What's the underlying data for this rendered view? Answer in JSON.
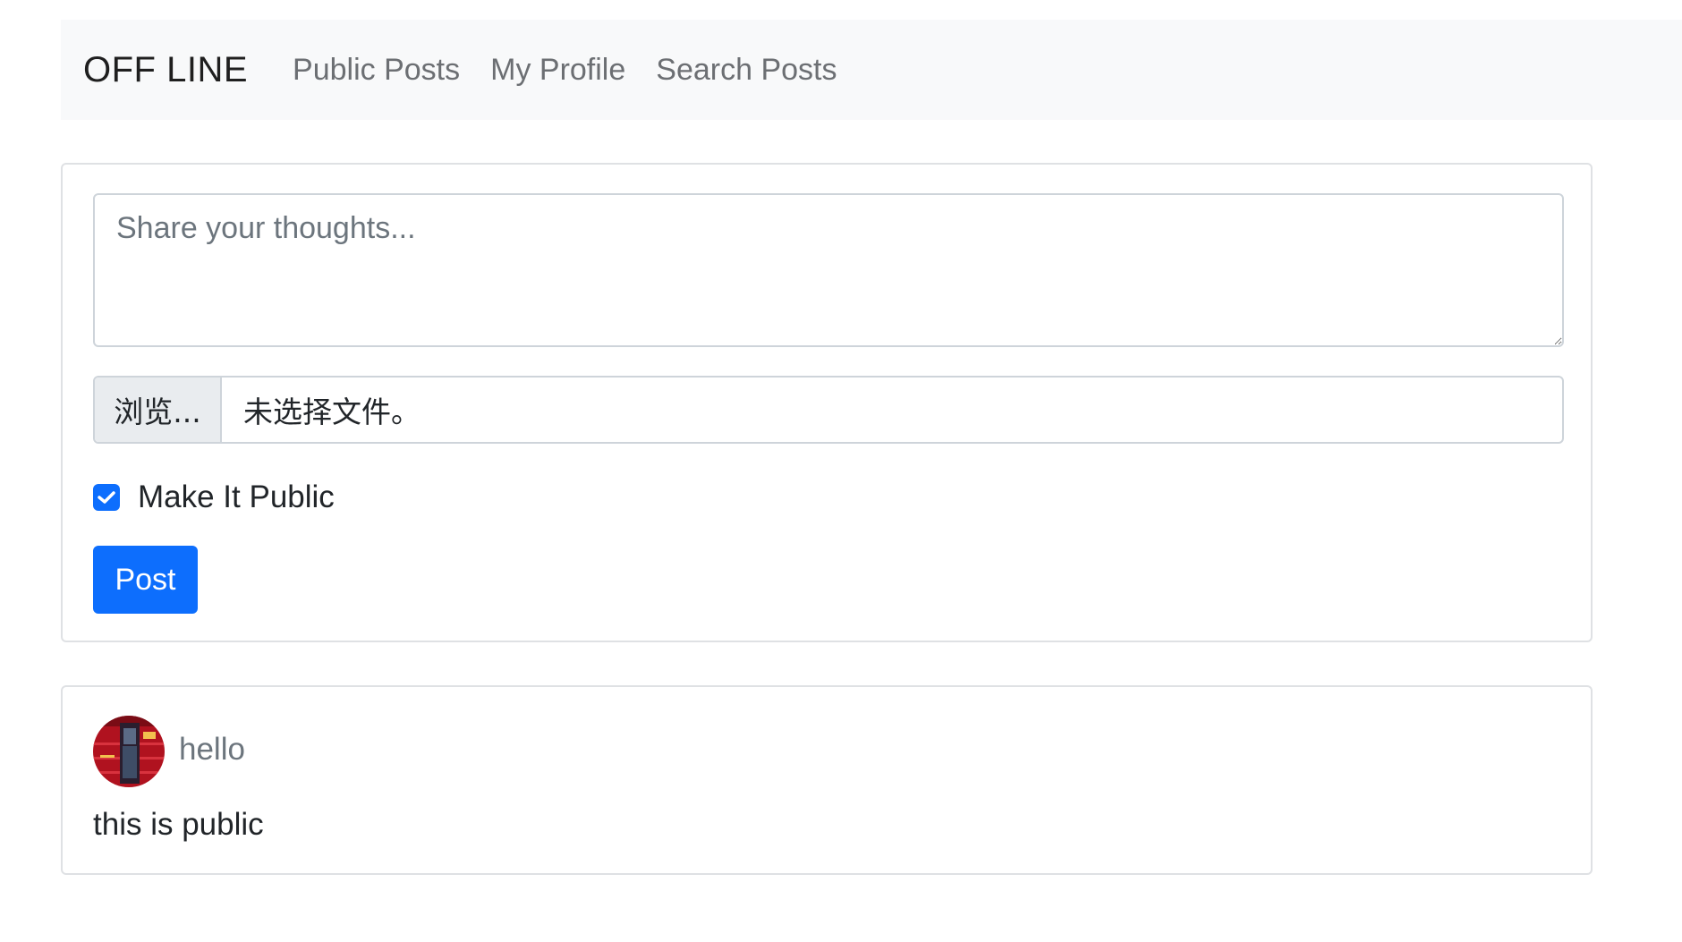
{
  "navbar": {
    "brand": "OFF LINE",
    "links": [
      "Public Posts",
      "My Profile",
      "Search Posts"
    ]
  },
  "composer": {
    "placeholder": "Share your thoughts...",
    "browse_label": "浏览...",
    "file_status": "未选择文件。",
    "public_checkbox": {
      "label": "Make It Public",
      "checked": true
    },
    "submit_label": "Post"
  },
  "posts": [
    {
      "author": "hello",
      "avatar_icon": "user-avatar",
      "body": "this is public"
    }
  ],
  "colors": {
    "primary": "#0d6efd",
    "navbar_bg": "#f8f9fa",
    "muted_text": "#6c757d"
  }
}
